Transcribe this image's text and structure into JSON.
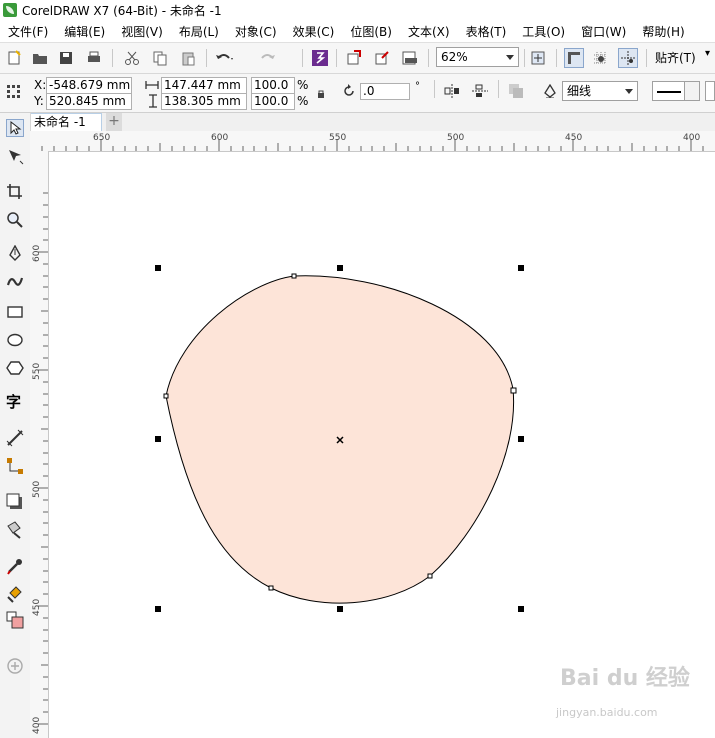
{
  "window": {
    "title": "CorelDRAW X7 (64-Bit) - 未命名 -1"
  },
  "menu": [
    "文件(F)",
    "编辑(E)",
    "视图(V)",
    "布局(L)",
    "对象(C)",
    "效果(C)",
    "位图(B)",
    "文本(X)",
    "表格(T)",
    "工具(O)",
    "窗口(W)",
    "帮助(H)"
  ],
  "toolbar": {
    "zoom_value": "62%",
    "snap_label": "贴齐(T)"
  },
  "property_bar": {
    "x_label": "X:",
    "y_label": "Y:",
    "x_value": "-548.679 mm",
    "y_value": "520.845 mm",
    "width_value": "147.447 mm",
    "height_value": "138.305 mm",
    "scale_w": "100.0",
    "scale_h": "100.0",
    "percent": "%",
    "rotation_value": ".0",
    "degree": "°",
    "outline_width": "细线"
  },
  "document_tab": {
    "label": "未命名 -1"
  },
  "ruler": {
    "top": [
      "650",
      "600",
      "550",
      "500",
      "450",
      "400"
    ],
    "left": [
      "600",
      "550",
      "500",
      "450",
      "400"
    ]
  },
  "shape": {
    "fill": "#fde4d8",
    "stroke": "#000000"
  },
  "watermark": {
    "text": "Bai du 经验",
    "url": "jingyan.baidu.com"
  }
}
